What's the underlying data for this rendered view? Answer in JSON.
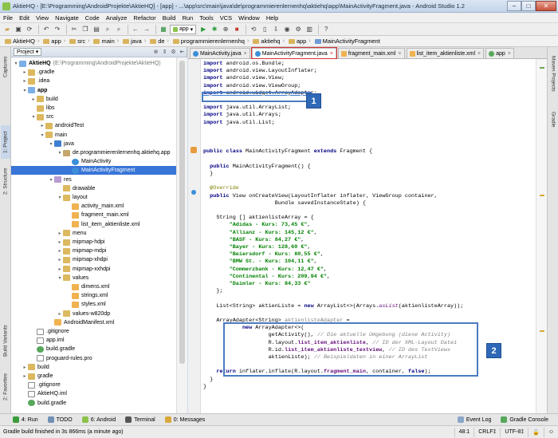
{
  "window": {
    "title": "AktieHQ - [E:\\Programming\\AndroidProjekte\\AktieHQ] - [app] - ...\\app\\src\\main\\java\\de\\programmierenlernenhq\\aktiehq\\app\\MainActivityFragment.java - Android Studio 1.2"
  },
  "menu": [
    "File",
    "Edit",
    "View",
    "Navigate",
    "Code",
    "Analyze",
    "Refactor",
    "Build",
    "Run",
    "Tools",
    "VCS",
    "Window",
    "Help"
  ],
  "toolbar": {
    "run_config": "app"
  },
  "breadcrumbs": [
    "AktieHQ",
    "app",
    "src",
    "main",
    "java",
    "de",
    "programmierenlernenhq",
    "aktiehq",
    "app",
    "MainActivityFragment"
  ],
  "left_tabs": [
    "1: Project",
    "2: Structure",
    "Captures",
    "Build Variants",
    "2: Favorites"
  ],
  "right_tabs": [
    "Maven Projects",
    "Gradle"
  ],
  "project_panel": {
    "view": "Project",
    "tree": [
      {
        "label": "AktieHQ",
        "hint": "(E:\\Programming\\AndroidProjekte\\AktieHQ)",
        "depth": 0,
        "icon": "module-icon",
        "arrow": "down",
        "bold": true
      },
      {
        "label": ".gradle",
        "depth": 1,
        "icon": "folder-icon",
        "arrow": "right"
      },
      {
        "label": ".idea",
        "depth": 1,
        "icon": "folder-icon",
        "arrow": "right"
      },
      {
        "label": "app",
        "depth": 1,
        "icon": "module-icon",
        "arrow": "down",
        "bold": true
      },
      {
        "label": "build",
        "depth": 2,
        "icon": "folder-icon",
        "arrow": "right"
      },
      {
        "label": "libs",
        "depth": 2,
        "icon": "folder-icon",
        "arrow": ""
      },
      {
        "label": "src",
        "depth": 2,
        "icon": "folder-icon",
        "arrow": "down"
      },
      {
        "label": "androidTest",
        "depth": 3,
        "icon": "folder-icon",
        "arrow": "right"
      },
      {
        "label": "main",
        "depth": 3,
        "icon": "folder-icon",
        "arrow": "down"
      },
      {
        "label": "java",
        "depth": 4,
        "icon": "java-folder-icon",
        "arrow": "down"
      },
      {
        "label": "de.programmierenlernenhq.aktiehq.app",
        "depth": 5,
        "icon": "package-icon",
        "arrow": "down"
      },
      {
        "label": "MainActivity",
        "depth": 6,
        "icon": "class-icon",
        "arrow": ""
      },
      {
        "label": "MainActivityFragment",
        "depth": 6,
        "icon": "class-icon",
        "arrow": "",
        "selected": true
      },
      {
        "label": "res",
        "depth": 4,
        "icon": "res-folder-icon",
        "arrow": "down"
      },
      {
        "label": "drawable",
        "depth": 5,
        "icon": "folder-icon",
        "arrow": ""
      },
      {
        "label": "layout",
        "depth": 5,
        "icon": "folder-icon",
        "arrow": "down"
      },
      {
        "label": "activity_main.xml",
        "depth": 6,
        "icon": "xml-icon",
        "arrow": ""
      },
      {
        "label": "fragment_main.xml",
        "depth": 6,
        "icon": "xml-icon",
        "arrow": ""
      },
      {
        "label": "list_item_aktienliste.xml",
        "depth": 6,
        "icon": "xml-icon",
        "arrow": ""
      },
      {
        "label": "menu",
        "depth": 5,
        "icon": "folder-icon",
        "arrow": "right"
      },
      {
        "label": "mipmap-hdpi",
        "depth": 5,
        "icon": "folder-icon",
        "arrow": "right"
      },
      {
        "label": "mipmap-mdpi",
        "depth": 5,
        "icon": "folder-icon",
        "arrow": "right"
      },
      {
        "label": "mipmap-xhdpi",
        "depth": 5,
        "icon": "folder-icon",
        "arrow": "right"
      },
      {
        "label": "mipmap-xxhdpi",
        "depth": 5,
        "icon": "folder-icon",
        "arrow": "right"
      },
      {
        "label": "values",
        "depth": 5,
        "icon": "folder-icon",
        "arrow": "down"
      },
      {
        "label": "dimens.xml",
        "depth": 6,
        "icon": "xml-icon",
        "arrow": ""
      },
      {
        "label": "strings.xml",
        "depth": 6,
        "icon": "xml-icon",
        "arrow": ""
      },
      {
        "label": "styles.xml",
        "depth": 6,
        "icon": "xml-icon",
        "arrow": ""
      },
      {
        "label": "values-w820dp",
        "depth": 5,
        "icon": "folder-icon",
        "arrow": "right"
      },
      {
        "label": "AndroidManifest.xml",
        "depth": 4,
        "icon": "xml-icon",
        "arrow": ""
      },
      {
        "label": ".gitignore",
        "depth": 2,
        "icon": "file-icon",
        "arrow": ""
      },
      {
        "label": "app.iml",
        "depth": 2,
        "icon": "file-icon",
        "arrow": ""
      },
      {
        "label": "build.gradle",
        "depth": 2,
        "icon": "gradle-icon",
        "arrow": ""
      },
      {
        "label": "proguard-rules.pro",
        "depth": 2,
        "icon": "file-icon",
        "arrow": ""
      },
      {
        "label": "build",
        "depth": 1,
        "icon": "folder-icon",
        "arrow": "right"
      },
      {
        "label": "gradle",
        "depth": 1,
        "icon": "folder-icon",
        "arrow": "right"
      },
      {
        "label": ".gitignore",
        "depth": 1,
        "icon": "file-icon",
        "arrow": ""
      },
      {
        "label": "AktieHQ.iml",
        "depth": 1,
        "icon": "file-icon",
        "arrow": ""
      },
      {
        "label": "build.gradle",
        "depth": 1,
        "icon": "gradle-icon",
        "arrow": ""
      }
    ]
  },
  "editor_tabs": [
    {
      "label": "MainActivity.java",
      "icon": "class-icon",
      "active": false
    },
    {
      "label": "MainActivityFragment.java",
      "icon": "class-icon",
      "active": true
    },
    {
      "label": "fragment_main.xml",
      "icon": "xml-icon",
      "active": false
    },
    {
      "label": "list_item_aktienliste.xml",
      "icon": "xml-icon",
      "active": false
    },
    {
      "label": "app",
      "icon": "gradle-icon",
      "active": false
    }
  ],
  "code_lines": [
    {
      "row": 0,
      "indent": 0,
      "parts": [
        [
          "kw",
          "import "
        ],
        [
          "",
          "android.os.Bundle;"
        ]
      ]
    },
    {
      "row": 1,
      "indent": 0,
      "parts": [
        [
          "kw",
          "import "
        ],
        [
          "",
          "android.view.LayoutInflater;"
        ]
      ]
    },
    {
      "row": 2,
      "indent": 0,
      "parts": [
        [
          "kw",
          "import "
        ],
        [
          "",
          "android.view.View;"
        ]
      ]
    },
    {
      "row": 3,
      "indent": 0,
      "parts": [
        [
          "kw",
          "import "
        ],
        [
          "",
          "android.view.ViewGroup;"
        ]
      ]
    },
    {
      "row": 4,
      "indent": 0,
      "parts": [
        [
          "kw ul",
          "import "
        ],
        [
          "ul",
          "android.widget.ArrayAdapter;"
        ]
      ]
    },
    {
      "row": 6,
      "indent": 0,
      "parts": [
        [
          "kw",
          "import "
        ],
        [
          "",
          "java.util.ArrayList;"
        ]
      ]
    },
    {
      "row": 7,
      "indent": 0,
      "parts": [
        [
          "kw",
          "import "
        ],
        [
          "",
          "java.util.Arrays;"
        ]
      ]
    },
    {
      "row": 8,
      "indent": 0,
      "parts": [
        [
          "kw",
          "import "
        ],
        [
          "",
          "java.util.List;"
        ]
      ]
    },
    {
      "row": 12,
      "indent": 0,
      "parts": [
        [
          "kw",
          "public class "
        ],
        [
          "",
          "MainActivityFragment "
        ],
        [
          "kw",
          "extends "
        ],
        [
          "",
          "Fragment {"
        ]
      ]
    },
    {
      "row": 14,
      "indent": 2,
      "parts": [
        [
          "kw",
          "public "
        ],
        [
          "",
          "MainActivityFragment() {"
        ]
      ]
    },
    {
      "row": 15,
      "indent": 2,
      "parts": [
        [
          "",
          "}"
        ]
      ]
    },
    {
      "row": 17,
      "indent": 2,
      "parts": [
        [
          "an",
          "@Override"
        ]
      ]
    },
    {
      "row": 18,
      "indent": 2,
      "parts": [
        [
          "kw",
          "public "
        ],
        [
          "",
          "View onCreateView(LayoutInflater inflater, ViewGroup container,"
        ]
      ]
    },
    {
      "row": 19,
      "indent": 22,
      "parts": [
        [
          "",
          "Bundle savedInstanceState) {"
        ]
      ]
    },
    {
      "row": 21,
      "indent": 4,
      "parts": [
        [
          "",
          "String [] aktienlisteArray = {"
        ]
      ]
    },
    {
      "row": 22,
      "indent": 8,
      "parts": [
        [
          "st",
          "\"Adidas - Kurs: 73,45 €\""
        ],
        [
          "",
          ","
        ]
      ]
    },
    {
      "row": 23,
      "indent": 8,
      "parts": [
        [
          "st",
          "\"Allianz - Kurs: 145,12 €\""
        ],
        [
          "",
          ","
        ]
      ]
    },
    {
      "row": 24,
      "indent": 8,
      "parts": [
        [
          "st",
          "\"BASF - Kurs: 84,27 €\""
        ],
        [
          "",
          ","
        ]
      ]
    },
    {
      "row": 25,
      "indent": 8,
      "parts": [
        [
          "st",
          "\"Bayer - Kurs: 128,60 €\""
        ],
        [
          "",
          ","
        ]
      ]
    },
    {
      "row": 26,
      "indent": 8,
      "parts": [
        [
          "st",
          "\"Beiersdorf - Kurs: 80,55 €\""
        ],
        [
          "",
          ","
        ]
      ]
    },
    {
      "row": 27,
      "indent": 8,
      "parts": [
        [
          "st",
          "\"BMW St. - Kurs: 104,11 €\""
        ],
        [
          "",
          ","
        ]
      ]
    },
    {
      "row": 28,
      "indent": 8,
      "parts": [
        [
          "st",
          "\"Commerzbank - Kurs: 12,47 €\""
        ],
        [
          "",
          ","
        ]
      ]
    },
    {
      "row": 29,
      "indent": 8,
      "parts": [
        [
          "st",
          "\"Continental - Kurs: 209,94 €\""
        ],
        [
          "",
          ","
        ]
      ]
    },
    {
      "row": 30,
      "indent": 8,
      "parts": [
        [
          "st",
          "\"Daimler - Kurs: 84,33 €\""
        ]
      ]
    },
    {
      "row": 31,
      "indent": 4,
      "parts": [
        [
          "",
          "};"
        ]
      ]
    },
    {
      "row": 33,
      "indent": 4,
      "parts": [
        [
          "",
          "List<String> aktienListe = "
        ],
        [
          "kw",
          "new "
        ],
        [
          "",
          "ArrayList<>(Arrays."
        ],
        [
          "fdi",
          "asList"
        ],
        [
          "",
          "(aktienlisteArray));"
        ]
      ]
    },
    {
      "row": 35,
      "indent": 4,
      "parts": [
        [
          "",
          "ArrayAdapter<String> "
        ],
        [
          "un",
          "aktienlisteAdapter"
        ],
        [
          "",
          " ="
        ]
      ]
    },
    {
      "row": 36,
      "indent": 12,
      "parts": [
        [
          "kw",
          "new "
        ],
        [
          "",
          "ArrayAdapter<>("
        ]
      ]
    },
    {
      "row": 37,
      "indent": 20,
      "parts": [
        [
          "",
          "getActivity(), "
        ],
        [
          "cm",
          "// Die aktuelle Umgebung (diese Activity)"
        ]
      ]
    },
    {
      "row": 38,
      "indent": 20,
      "parts": [
        [
          "",
          "R.layout."
        ],
        [
          "fd",
          "list_item_aktienliste"
        ],
        [
          "",
          ", "
        ],
        [
          "cm",
          "// ID der XML-Layout Datei"
        ]
      ]
    },
    {
      "row": 39,
      "indent": 20,
      "parts": [
        [
          "",
          "R.id."
        ],
        [
          "fd",
          "list_item_aktienliste_textview"
        ],
        [
          "",
          ", "
        ],
        [
          "cm",
          "// ID des TextViews"
        ]
      ]
    },
    {
      "row": 40,
      "indent": 20,
      "parts": [
        [
          "",
          "aktienListe); "
        ],
        [
          "cm",
          "// Beispieldaten in einer ArrayList"
        ]
      ]
    },
    {
      "row": 42,
      "indent": 4,
      "parts": [
        [
          "kw",
          "return "
        ],
        [
          "",
          "inflater.inflate(R.layout."
        ],
        [
          "fd",
          "fragment_main"
        ],
        [
          "",
          ", container, "
        ],
        [
          "kw",
          "false"
        ],
        [
          "",
          ");"
        ]
      ]
    },
    {
      "row": 43,
      "indent": 2,
      "parts": [
        [
          "",
          "}"
        ]
      ]
    },
    {
      "row": 44,
      "indent": 0,
      "parts": [
        [
          "",
          "}"
        ]
      ]
    }
  ],
  "callouts": [
    {
      "label": "1"
    },
    {
      "label": "2"
    }
  ],
  "bottom_tools": [
    {
      "label": "4: Run",
      "icon": "run-icon"
    },
    {
      "label": "TODO",
      "icon": "todo-icon"
    },
    {
      "label": "6: Android",
      "icon": "android-icon"
    },
    {
      "label": "Terminal",
      "icon": "terminal-icon"
    },
    {
      "label": "0: Messages",
      "icon": "messages-icon"
    }
  ],
  "bottom_right_tools": [
    {
      "label": "Event Log",
      "icon": "event-log-icon"
    },
    {
      "label": "Gradle Console",
      "icon": "gradle-console-icon"
    }
  ],
  "status": {
    "message": "Gradle build finished in 3s 866ms (a minute ago)",
    "position": "48:1",
    "line_sep": "CRLF‡",
    "encoding": "UTF-8‡"
  }
}
